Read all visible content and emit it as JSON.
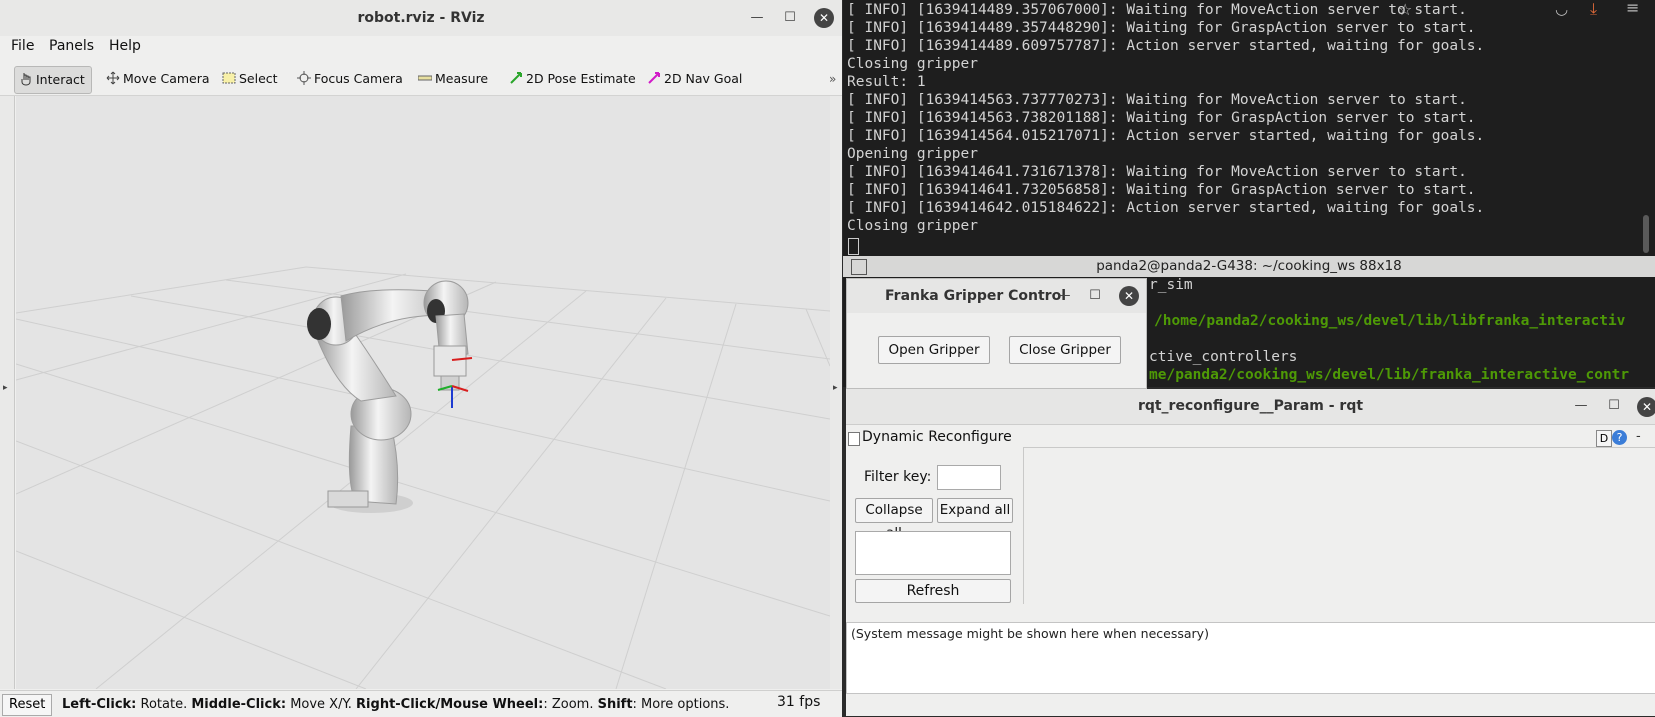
{
  "rviz": {
    "title": "robot.rviz - RViz",
    "menu": [
      "File",
      "Panels",
      "Help"
    ],
    "tools": [
      "Interact",
      "Move Camera",
      "Select",
      "Focus Camera",
      "Measure",
      "2D Pose Estimate",
      "2D Nav Goal"
    ],
    "more": "»",
    "status": {
      "reset": "Reset",
      "left_click_k": "Left-Click:",
      "left_click_v": "Rotate.",
      "middle_k": "Middle-Click:",
      "middle_v": "Move X/Y.",
      "right_k": "Right-Click/Mouse Wheel:",
      "right_v": ": Zoom.",
      "shift_k": "Shift",
      "shift_v": ": More options.",
      "fps": "31 fps"
    }
  },
  "terminal": {
    "lines": [
      "[ INFO] [1639414489.357067000]: Waiting for MoveAction server to start.",
      "[ INFO] [1639414489.357448290]: Waiting for GraspAction server to start.",
      "[ INFO] [1639414489.609757787]: Action server started, waiting for goals.",
      "Closing gripper",
      "Result: 1",
      "[ INFO] [1639414563.737770273]: Waiting for MoveAction server to start.",
      "[ INFO] [1639414563.738201188]: Waiting for GraspAction server to start.",
      "[ INFO] [1639414564.015217071]: Action server started, waiting for goals.",
      "Opening gripper",
      "[ INFO] [1639414641.731671378]: Waiting for MoveAction server to start.",
      "[ INFO] [1639414641.732056858]: Waiting for GraspAction server to start.",
      "[ INFO] [1639414642.015184622]: Action server started, waiting for goals.",
      "Closing gripper"
    ],
    "second_title": "panda2@panda2-G438: ~/cooking_ws 88x18",
    "second_lines": [
      "r_sim",
      "/home/panda2/cooking_ws/devel/lib/libfranka_interactiv",
      "ctive_controllers",
      "me/panda2/cooking_ws/devel/lib/franka_interactive_contr"
    ]
  },
  "gripper": {
    "title": "Franka Gripper Control",
    "open": "Open Gripper",
    "close": "Close Gripper"
  },
  "rqt": {
    "title": "rqt_reconfigure__Param - rqt",
    "plugin": "Dynamic Reconfigure",
    "filter_label": "Filter key:",
    "collapse": "Collapse all",
    "expand": "Expand all",
    "refresh": "Refresh",
    "message": "(System message might be shown here when necessary)",
    "help_d": "D",
    "help_q": "?"
  },
  "colors": {
    "terminal_bg": "#1e1e1e",
    "terminal_green": "#4e9a06",
    "rviz_bg": "#e4e4e4"
  }
}
